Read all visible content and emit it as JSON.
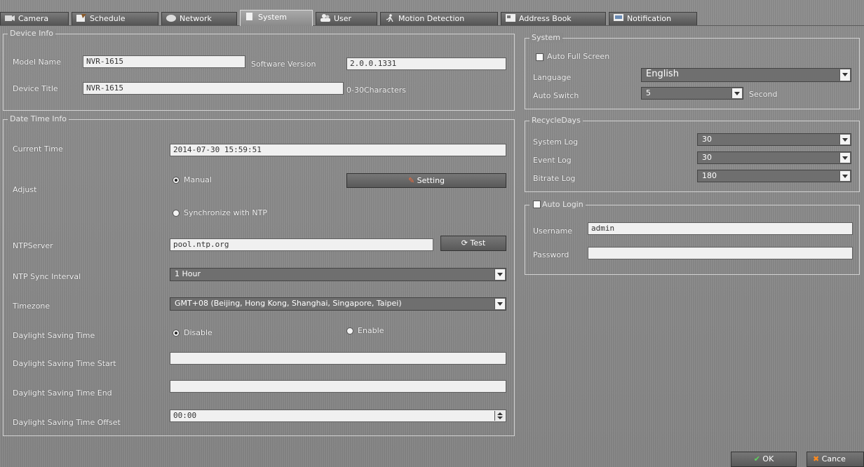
{
  "tabs": [
    {
      "label": "Camera",
      "icon": "camera-icon",
      "active": false
    },
    {
      "label": "Schedule",
      "icon": "schedule-icon",
      "active": false
    },
    {
      "label": "Network",
      "icon": "network-icon",
      "active": false
    },
    {
      "label": "System",
      "icon": "system-icon",
      "active": true
    },
    {
      "label": "User",
      "icon": "user-icon",
      "active": false
    },
    {
      "label": "Motion Detection",
      "icon": "motion-icon",
      "active": false
    },
    {
      "label": "Address Book",
      "icon": "address-book-icon",
      "active": false
    },
    {
      "label": "Notification",
      "icon": "notification-icon",
      "active": false
    }
  ],
  "device_info": {
    "legend": "Device Info",
    "model_label": "Model Name",
    "model_value": "NVR-1615",
    "software_label": "Software Version",
    "software_value": "2.0.0.1331",
    "title_label": "Device Title",
    "title_value": "NVR-1615",
    "title_hint": "0-30Characters"
  },
  "datetime": {
    "legend": "Date Time Info",
    "current_time_label": "Current Time",
    "current_time_value": "2014-07-30 15:59:51",
    "adjust_label": "Adjust",
    "manual_label": "Manual",
    "setting_button": "Setting",
    "ntp_option_label": "Synchronize with NTP",
    "ntp_server_label": "NTPServer",
    "ntp_server_value": "pool.ntp.org",
    "test_button": "Test",
    "interval_label": "NTP Sync Interval",
    "interval_value": "1 Hour",
    "timezone_label": "Timezone",
    "timezone_value": "GMT+08 (Beijing, Hong Kong, Shanghai, Singapore, Taipei)",
    "dst_label": "Daylight Saving Time",
    "dst_disable": "Disable",
    "dst_enable": "Enable",
    "dst_start_label": "Daylight Saving Time Start",
    "dst_start_value": "",
    "dst_end_label": "Daylight Saving Time End",
    "dst_end_value": "",
    "dst_offset_label": "Daylight Saving Time Offset",
    "dst_offset_value": "00:00"
  },
  "system": {
    "legend": "System",
    "auto_full_screen_label": "Auto Full Screen",
    "language_label": "Language",
    "language_value": "English",
    "auto_switch_label": "Auto Switch",
    "auto_switch_value": "5",
    "auto_switch_unit": "Second"
  },
  "recycle": {
    "legend": "RecycleDays",
    "system_log_label": "System Log",
    "system_log_value": "30",
    "event_log_label": "Event Log",
    "event_log_value": "30",
    "bitrate_log_label": "Bitrate Log",
    "bitrate_log_value": "180"
  },
  "auto_login": {
    "legend": "Auto Login",
    "username_label": "Username",
    "username_value": "admin",
    "password_label": "Password",
    "password_value": ""
  },
  "footer": {
    "ok_label": "OK",
    "cancel_label": "Cance"
  },
  "colors": {
    "background": "#8c8c8c",
    "field": "#f0f0f0",
    "ok_icon": "#4caf50",
    "cancel_icon": "#e8801e"
  }
}
